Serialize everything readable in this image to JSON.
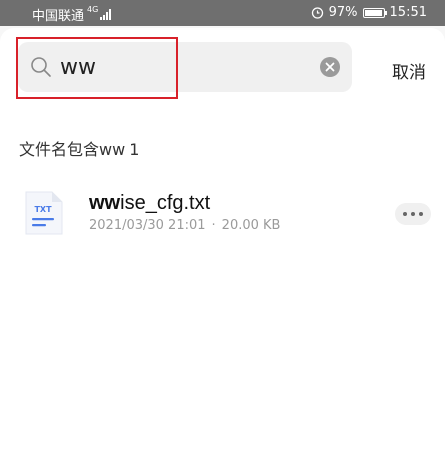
{
  "status_bar": {
    "carrier": "中国联通",
    "network": "4G",
    "battery": "97%",
    "battery_level": 0.97,
    "time": "15:51"
  },
  "search": {
    "value": "ww",
    "placeholder": "",
    "cancel_label": "取消"
  },
  "results": {
    "heading": "文件名包含ww",
    "count": "1"
  },
  "files": [
    {
      "name_match": "ww",
      "name_rest": "ise_cfg.txt",
      "type_label": "TXT",
      "date": "2021/03/30 21:01",
      "separator": "·",
      "size": "20.00 KB"
    }
  ],
  "colors": {
    "highlight": "#d8212a",
    "status_bar": "#6f6f6f",
    "txt_icon_accent": "#4a7be8"
  }
}
